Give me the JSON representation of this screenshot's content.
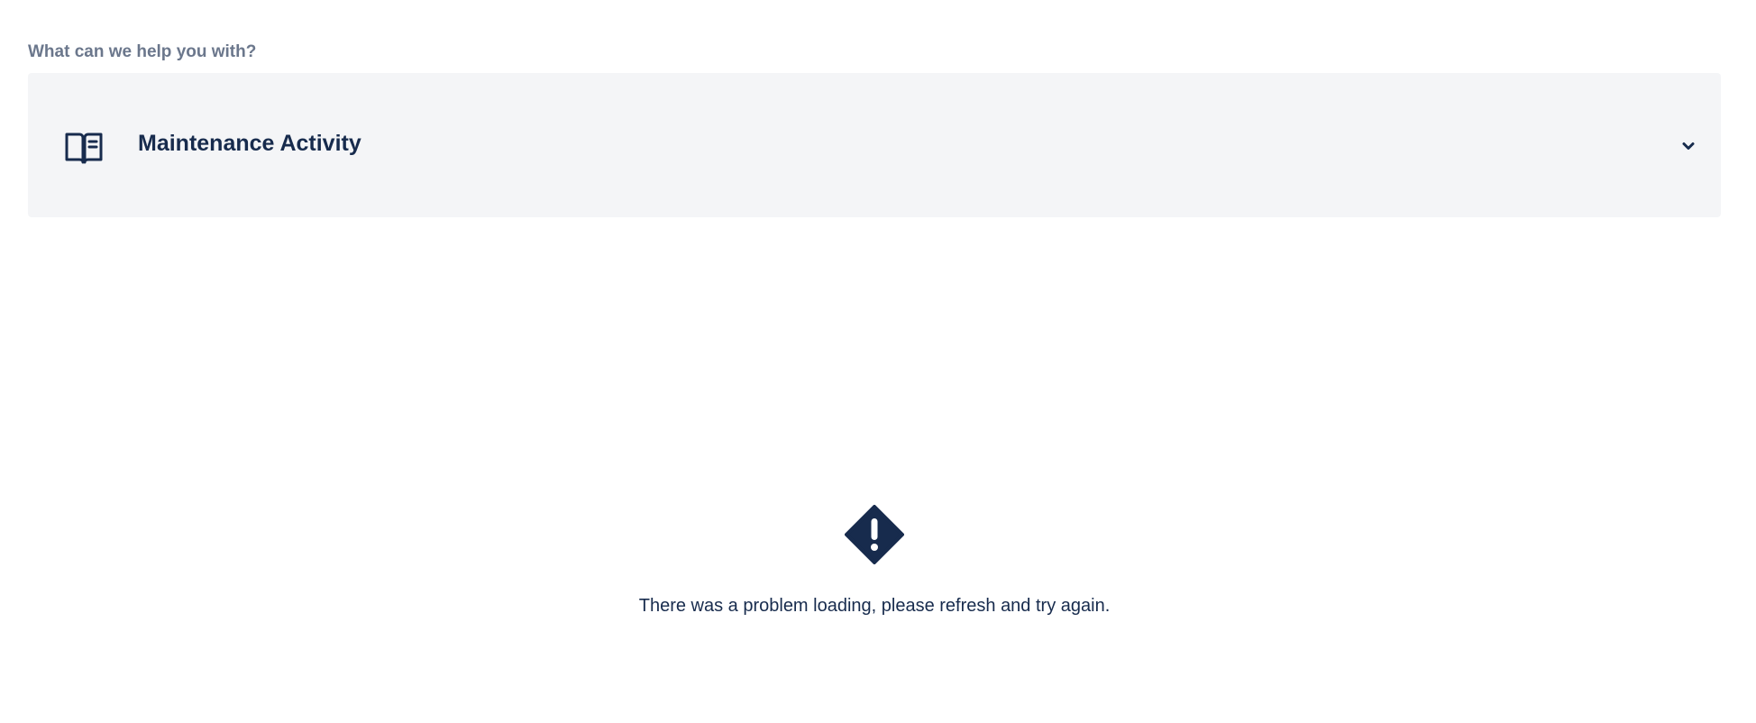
{
  "form": {
    "prompt_label": "What can we help you with?",
    "request_type": {
      "name": "Maintenance Activity",
      "icon": "book-icon",
      "dropdown_icon": "chevron-down-icon"
    }
  },
  "error": {
    "icon": "warning-diamond-icon",
    "message": "There was a problem loading, please refresh and try again."
  },
  "colors": {
    "text_primary": "#172b4d",
    "text_subtle": "#6b778c",
    "select_background": "#f4f5f7",
    "icon_dark": "#172b4d"
  }
}
